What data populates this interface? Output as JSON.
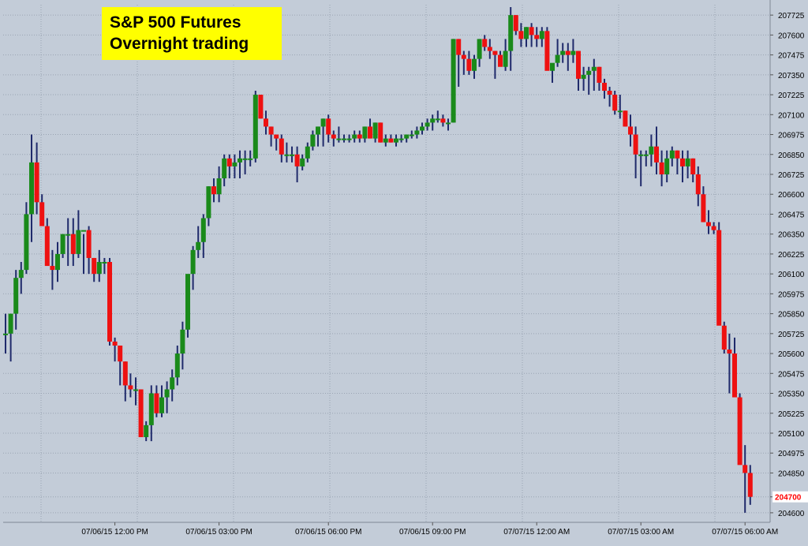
{
  "title_box": {
    "line1": "S&P 500 Futures",
    "line2": "Overnight trading"
  },
  "last_price_label": "204700",
  "colors": {
    "background": "#c3ccd8",
    "grid": "#9aa4b2",
    "up_candle": "#1a8a1a",
    "down_candle": "#ee1111",
    "wick": "#1f2a6b",
    "title_box": "#ffff00",
    "last_price": "#ff0000"
  },
  "chart_data": {
    "type": "candlestick",
    "title": "S&P 500 Futures Overnight trading",
    "xlabel": "",
    "ylabel": "",
    "ylim": [
      204550,
      207800
    ],
    "grid": true,
    "y_ticks": [
      "207725",
      "207600",
      "207475",
      "207350",
      "207225",
      "207100",
      "206975",
      "206850",
      "206725",
      "206600",
      "206475",
      "206350",
      "206225",
      "206100",
      "205975",
      "205850",
      "205725",
      "205600",
      "205475",
      "205350",
      "205225",
      "205100",
      "204975",
      "204850",
      "204700",
      "204600"
    ],
    "x_ticks": [
      "07/06/15 12:00 PM",
      "07/06/15 03:00 PM",
      "07/06/15 06:00 PM",
      "07/06/15 09:00 PM",
      "07/07/15 12:00 AM",
      "07/07/15 03:00 AM",
      "07/07/15 06:00 AM"
    ],
    "x_tick_bar_index": [
      21,
      41,
      62,
      82,
      102,
      122,
      142
    ],
    "candles": [
      [
        205725,
        205850,
        205600,
        205725
      ],
      [
        205725,
        205850,
        205550,
        205850
      ],
      [
        205850,
        206125,
        205750,
        206075
      ],
      [
        206075,
        206175,
        205975,
        206125
      ],
      [
        206125,
        206550,
        206100,
        206475
      ],
      [
        206475,
        206975,
        206300,
        206800
      ],
      [
        206800,
        206925,
        206475,
        206550
      ],
      [
        206550,
        206600,
        206425,
        206400
      ],
      [
        206400,
        206450,
        206200,
        206150
      ],
      [
        206150,
        206250,
        206000,
        206125
      ],
      [
        206125,
        206300,
        206050,
        206225
      ],
      [
        206225,
        206350,
        206200,
        206350
      ],
      [
        206350,
        206450,
        206150,
        206350
      ],
      [
        206350,
        206450,
        206150,
        206225
      ],
      [
        206225,
        206500,
        206200,
        206375
      ],
      [
        206375,
        206350,
        206100,
        206375
      ],
      [
        206375,
        206400,
        206100,
        206200
      ],
      [
        206200,
        206200,
        206050,
        206100
      ],
      [
        206100,
        206250,
        206050,
        206175
      ],
      [
        206175,
        206200,
        206100,
        206175
      ],
      [
        206175,
        206200,
        205650,
        205675
      ],
      [
        205675,
        205700,
        205550,
        205650
      ],
      [
        205650,
        205650,
        205400,
        205550
      ],
      [
        205550,
        205550,
        205300,
        205400
      ],
      [
        205400,
        205475,
        205325,
        205375
      ],
      [
        205375,
        205450,
        205275,
        205375
      ],
      [
        205375,
        205375,
        205100,
        205075
      ],
      [
        205075,
        205175,
        205050,
        205150
      ],
      [
        205150,
        205400,
        205050,
        205350
      ],
      [
        205350,
        205400,
        205200,
        205225
      ],
      [
        205225,
        205400,
        205200,
        205325
      ],
      [
        205325,
        205425,
        205225,
        205375
      ],
      [
        205375,
        205500,
        205300,
        205450
      ],
      [
        205450,
        205650,
        205400,
        205600
      ],
      [
        205600,
        205800,
        205500,
        205750
      ],
      [
        205750,
        206050,
        205700,
        206100
      ],
      [
        206100,
        206275,
        206000,
        206250
      ],
      [
        206250,
        206400,
        206200,
        206300
      ],
      [
        206300,
        206475,
        206200,
        206450
      ],
      [
        206450,
        206650,
        206400,
        206650
      ],
      [
        206650,
        206700,
        206550,
        206600
      ],
      [
        206600,
        206775,
        206550,
        206700
      ],
      [
        206700,
        206850,
        206650,
        206825
      ],
      [
        206825,
        206850,
        206700,
        206775
      ],
      [
        206775,
        206850,
        206700,
        206800
      ],
      [
        206800,
        206875,
        206700,
        206825
      ],
      [
        206825,
        206875,
        206725,
        206825
      ],
      [
        206825,
        206875,
        206775,
        206825
      ],
      [
        206825,
        207250,
        206800,
        207225
      ],
      [
        207225,
        207225,
        207075,
        207075
      ],
      [
        207075,
        207125,
        206975,
        207025
      ],
      [
        207025,
        207025,
        206900,
        206975
      ],
      [
        206975,
        206975,
        206875,
        206950
      ],
      [
        206950,
        206975,
        206800,
        206850
      ],
      [
        206850,
        206925,
        206800,
        206850
      ],
      [
        206850,
        206900,
        206800,
        206850
      ],
      [
        206850,
        206900,
        206675,
        206775
      ],
      [
        206775,
        206850,
        206750,
        206825
      ],
      [
        206825,
        206925,
        206800,
        206900
      ],
      [
        206900,
        207000,
        206875,
        206975
      ],
      [
        206975,
        207025,
        206900,
        207025
      ],
      [
        207025,
        207075,
        206900,
        207075
      ],
      [
        207075,
        207100,
        206925,
        206975
      ],
      [
        206975,
        207000,
        206900,
        206950
      ],
      [
        206950,
        207025,
        206925,
        206950
      ],
      [
        206950,
        206975,
        206925,
        206950
      ],
      [
        206950,
        206975,
        206925,
        206950
      ],
      [
        206950,
        207000,
        206925,
        206975
      ],
      [
        206975,
        207000,
        206925,
        206950
      ],
      [
        206950,
        207025,
        206925,
        207025
      ],
      [
        207025,
        207075,
        206950,
        206950
      ],
      [
        206950,
        207050,
        206925,
        207050
      ],
      [
        207050,
        207050,
        206925,
        206925
      ],
      [
        206925,
        206975,
        206900,
        206950
      ],
      [
        206950,
        206975,
        206925,
        206925
      ],
      [
        206925,
        206975,
        206900,
        206950
      ],
      [
        206950,
        206975,
        206925,
        206950
      ],
      [
        206950,
        206975,
        206925,
        206975
      ],
      [
        206975,
        207000,
        206950,
        206975
      ],
      [
        206975,
        207025,
        206950,
        207000
      ],
      [
        207000,
        207050,
        206975,
        207025
      ],
      [
        207025,
        207075,
        207000,
        207050
      ],
      [
        207050,
        207100,
        207000,
        207075
      ],
      [
        207075,
        207125,
        207050,
        207075
      ],
      [
        207075,
        207100,
        207025,
        207050
      ],
      [
        207050,
        207075,
        207000,
        207050
      ],
      [
        207050,
        207575,
        207050,
        207575
      ],
      [
        207575,
        207575,
        207275,
        207475
      ],
      [
        207475,
        207500,
        207350,
        207450
      ],
      [
        207450,
        207500,
        207350,
        207375
      ],
      [
        207375,
        207475,
        207325,
        207450
      ],
      [
        207450,
        207575,
        207400,
        207575
      ],
      [
        207575,
        207600,
        207500,
        207525
      ],
      [
        207525,
        207575,
        207450,
        207500
      ],
      [
        207500,
        207500,
        207325,
        207475
      ],
      [
        207475,
        207500,
        207425,
        207400
      ],
      [
        207400,
        207575,
        207375,
        207500
      ],
      [
        207500,
        207775,
        207375,
        207725
      ],
      [
        207725,
        207725,
        207600,
        207625
      ],
      [
        207625,
        207675,
        207525,
        207575
      ],
      [
        207575,
        207650,
        207525,
        207650
      ],
      [
        207650,
        207675,
        207525,
        207600
      ],
      [
        207600,
        207650,
        207525,
        207575
      ],
      [
        207575,
        207650,
        207525,
        207625
      ],
      [
        207625,
        207650,
        207400,
        207375
      ],
      [
        207375,
        207400,
        207300,
        207425
      ],
      [
        207425,
        207575,
        207400,
        207475
      ],
      [
        207475,
        207550,
        207425,
        207500
      ],
      [
        207500,
        207550,
        207375,
        207475
      ],
      [
        207475,
        207575,
        207425,
        207500
      ],
      [
        207500,
        207500,
        207250,
        207325
      ],
      [
        207325,
        207400,
        207250,
        207350
      ],
      [
        207350,
        207400,
        207225,
        207375
      ],
      [
        207375,
        207450,
        207250,
        207400
      ],
      [
        207400,
        207400,
        207250,
        207300
      ],
      [
        207300,
        207325,
        207200,
        207250
      ],
      [
        207250,
        207275,
        207150,
        207225
      ],
      [
        207225,
        207250,
        207100,
        207125
      ],
      [
        207125,
        207225,
        207075,
        207125
      ],
      [
        207125,
        207125,
        207025,
        207025
      ],
      [
        207025,
        207100,
        206900,
        206975
      ],
      [
        206975,
        207025,
        206700,
        206850
      ],
      [
        206850,
        206875,
        206650,
        206850
      ],
      [
        206850,
        206875,
        206775,
        206850
      ],
      [
        206850,
        206975,
        206775,
        206900
      ],
      [
        206900,
        207025,
        206725,
        206800
      ],
      [
        206800,
        206875,
        206650,
        206725
      ],
      [
        206725,
        206875,
        206675,
        206825
      ],
      [
        206825,
        206900,
        206775,
        206875
      ],
      [
        206875,
        206875,
        206725,
        206825
      ],
      [
        206825,
        206875,
        206675,
        206775
      ],
      [
        206775,
        206875,
        206700,
        206825
      ],
      [
        206825,
        206825,
        206675,
        206725
      ],
      [
        206725,
        206775,
        206525,
        206600
      ],
      [
        206600,
        206650,
        206425,
        206425
      ],
      [
        206425,
        206500,
        206350,
        206400
      ],
      [
        206400,
        206425,
        206350,
        206375
      ],
      [
        206375,
        206425,
        206175,
        205775
      ],
      [
        205775,
        205800,
        205600,
        205625
      ],
      [
        205625,
        205725,
        205350,
        205600
      ],
      [
        205600,
        205700,
        205500,
        205325
      ],
      [
        205325,
        205350,
        205000,
        204900
      ],
      [
        204900,
        205025,
        204600,
        204850
      ],
      [
        204850,
        204900,
        204650,
        204700
      ]
    ]
  }
}
